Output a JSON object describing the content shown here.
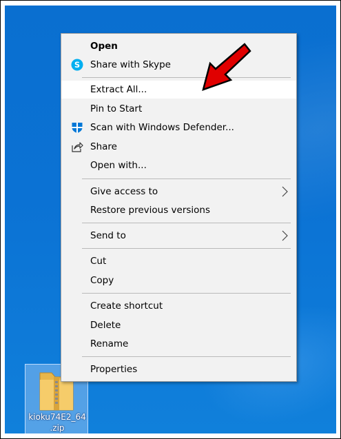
{
  "context_menu": {
    "items": [
      {
        "label": "Open",
        "bold": true,
        "icon": null,
        "submenu": false
      },
      {
        "label": "Share with Skype",
        "icon": "skype-icon",
        "submenu": false
      },
      {
        "label": "Extract All...",
        "highlighted": true,
        "submenu": false
      },
      {
        "label": "Pin to Start",
        "submenu": false
      },
      {
        "label": "Scan with Windows Defender...",
        "icon": "windows-defender-icon",
        "submenu": false
      },
      {
        "label": "Share",
        "icon": "share-icon",
        "submenu": false
      },
      {
        "label": "Open with...",
        "submenu": false
      },
      {
        "label": "Give access to",
        "submenu": true
      },
      {
        "label": "Restore previous versions",
        "submenu": false
      },
      {
        "label": "Send to",
        "submenu": true
      },
      {
        "label": "Cut",
        "submenu": false
      },
      {
        "label": "Copy",
        "submenu": false
      },
      {
        "label": "Create shortcut",
        "submenu": false
      },
      {
        "label": "Delete",
        "submenu": false
      },
      {
        "label": "Rename",
        "submenu": false
      },
      {
        "label": "Properties",
        "submenu": false
      }
    ]
  },
  "desktop_icon": {
    "filename_line1": "kioku74E2_64",
    "filename_line2": ".zip",
    "icon": "zip-folder-icon"
  },
  "annotation": {
    "icon": "red-arrow-icon",
    "color": "#e00000"
  },
  "colors": {
    "desktop_blue": "#0b72d4",
    "menu_bg": "#f2f2f2",
    "skype_blue": "#00aff0",
    "defender_blue": "#0078d7"
  }
}
